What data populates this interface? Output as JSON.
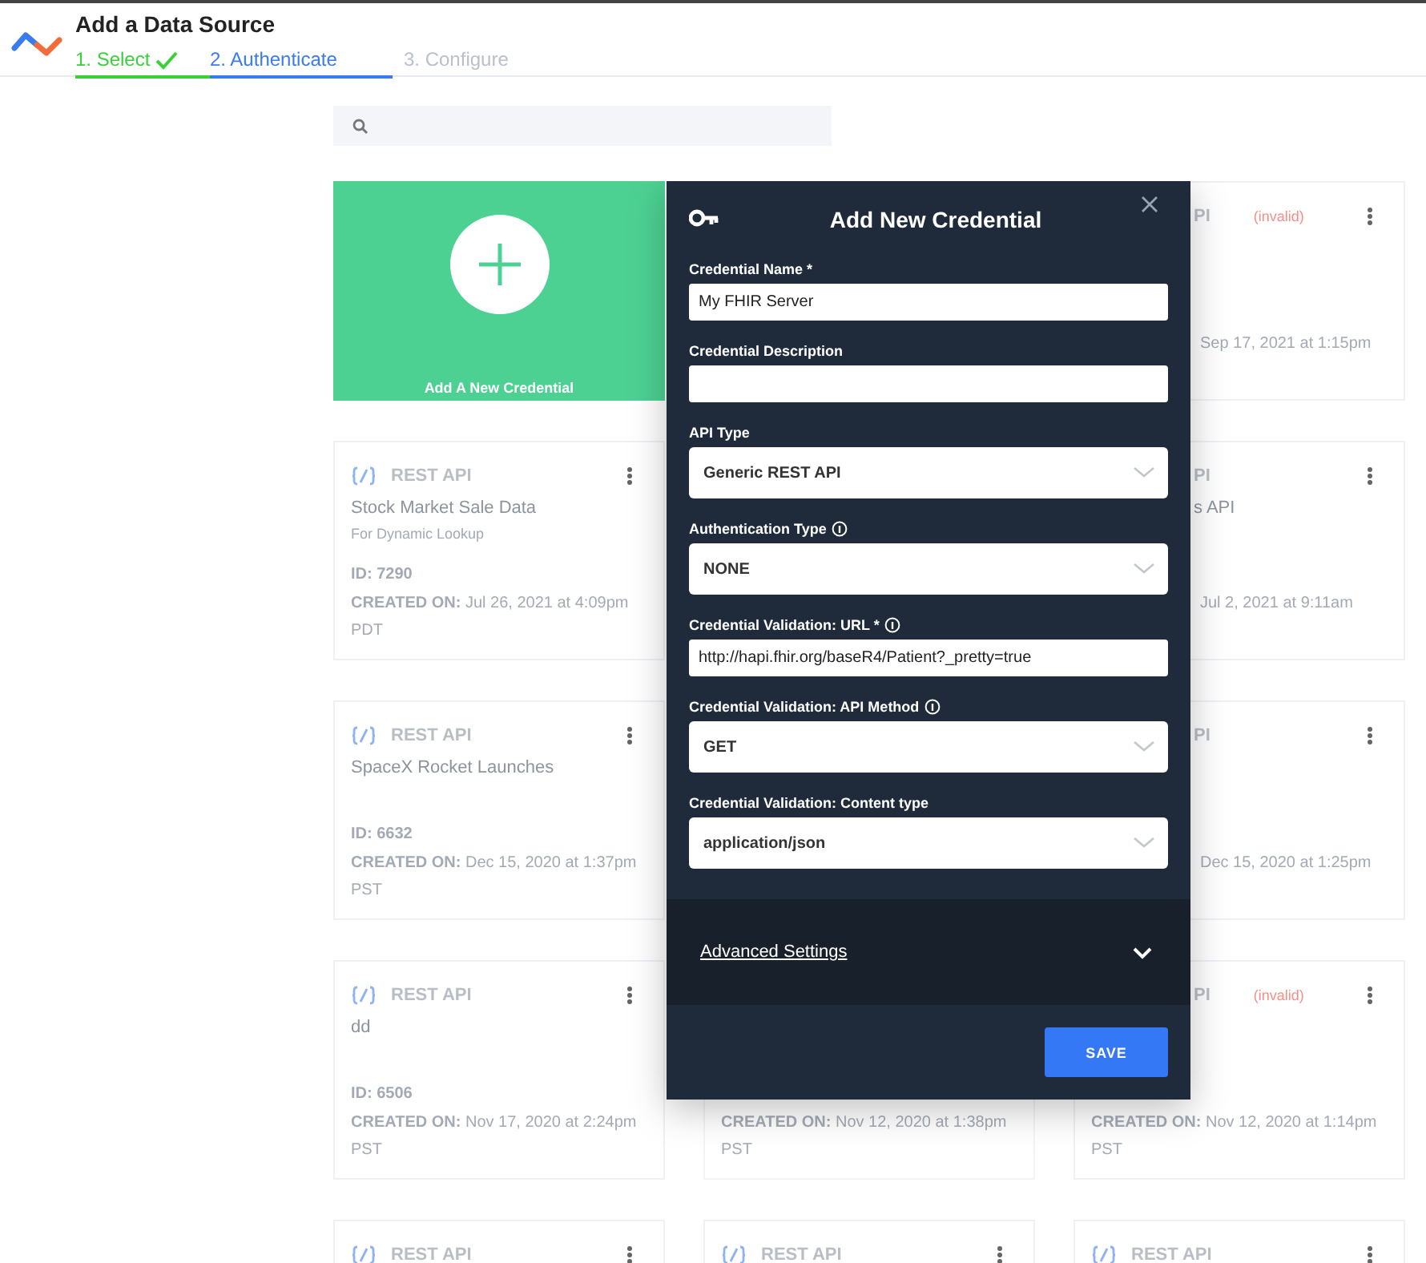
{
  "header": {
    "title": "Add a Data Source",
    "steps": [
      {
        "label": "1. Select",
        "completed": true,
        "selected": false
      },
      {
        "label": "2. Authenticate",
        "completed": false,
        "selected": true
      },
      {
        "label": "3. Configure",
        "completed": false,
        "selected": false
      }
    ]
  },
  "cards": [
    {
      "kind": "add",
      "label": "Add A New Credential"
    },
    {
      "kind": "covered"
    },
    {
      "kind": "partial",
      "type_label": "PI",
      "invalid": "(invalid)",
      "created": "Sep 17, 2021 at 1:15pm"
    },
    {
      "kind": "full",
      "type_label": "REST API",
      "name": "Stock Market Sale Data",
      "subtitle": "For Dynamic Lookup",
      "id": "ID: 7290",
      "created": "**CREATED ON:** Jul 26, 2021 at 4:09pm PDT"
    },
    {
      "kind": "covered"
    },
    {
      "kind": "partial",
      "type_label": "PI",
      "name": "s API",
      "created": "Jul 2, 2021 at 9:11am"
    },
    {
      "kind": "full",
      "type_label": "REST API",
      "name": "SpaceX Rocket Launches",
      "id": "ID: 6632",
      "created": "**CREATED ON:** Dec 15, 2020 at 1:37pm PST"
    },
    {
      "kind": "covered"
    },
    {
      "kind": "partial",
      "type_label": "PI",
      "created": "Dec 15, 2020 at 1:25pm"
    },
    {
      "kind": "full",
      "type_label": "REST API",
      "name": "dd",
      "id": "ID: 6506",
      "created": "**CREATED ON:** Nov 17, 2020 at 2:24pm PST"
    },
    {
      "kind": "lower",
      "created": "**CREATED ON:** Nov 12, 2020 at 1:38pm PST"
    },
    {
      "kind": "partial_top",
      "type_label": "PI",
      "invalid": "(invalid)",
      "created": "**CREATED ON:** Nov 12, 2020 at 1:14pm PST"
    },
    {
      "kind": "full",
      "type_label": "REST API"
    },
    {
      "kind": "full",
      "type_label": "REST API"
    },
    {
      "kind": "full",
      "type_label": "REST API"
    }
  ],
  "modal": {
    "title": "Add New Credential",
    "fields": [
      {
        "kind": "text",
        "label": "Credential Name *",
        "info": false,
        "value": "My FHIR Server"
      },
      {
        "kind": "text",
        "label": "Credential Description",
        "info": false
      },
      {
        "kind": "select",
        "label": "API Type",
        "info": false,
        "value": "Generic REST API"
      },
      {
        "kind": "select",
        "label": "Authentication Type",
        "info": true,
        "value": "NONE"
      },
      {
        "kind": "text",
        "label": "Credential Validation: URL *",
        "info": true,
        "value": "http://hapi.fhir.org/baseR4/Patient?_pretty=true"
      },
      {
        "kind": "select",
        "label": "Credential Validation: API Method",
        "info": true,
        "value": "GET"
      },
      {
        "kind": "select",
        "label": "Credential Validation: Content type",
        "info": false,
        "value": "application/json"
      }
    ],
    "advanced": {
      "label": "Advanced Settings",
      "expanded": false
    },
    "save": "SAVE"
  }
}
